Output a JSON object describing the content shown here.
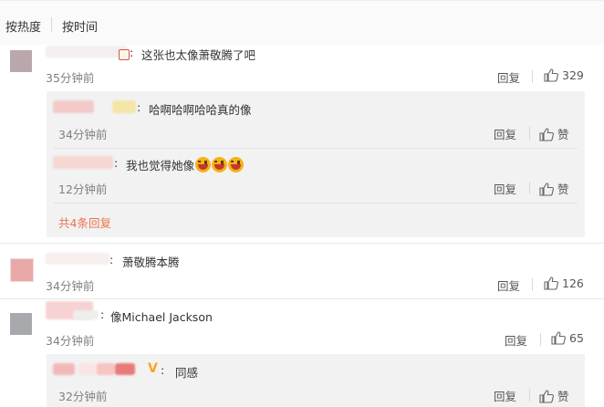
{
  "sort": {
    "hot": "按热度",
    "time": "按时间"
  },
  "comments": [
    {
      "text": "这张也太像萧敬腾了吧",
      "time": "35分钟前",
      "reply": "回复",
      "likes": "329",
      "replies": [
        {
          "text": "哈啊哈啊哈哈真的像",
          "time": "34分钟前",
          "reply": "回复",
          "like": "赞"
        },
        {
          "text": "我也觉得她像",
          "time": "12分钟前",
          "reply": "回复",
          "like": "赞",
          "emoji_count": 3
        }
      ],
      "more": "共4条回复"
    },
    {
      "text": "萧敬腾本腾",
      "time": "34分钟前",
      "reply": "回复",
      "likes": "126"
    },
    {
      "text": "像Michael Jackson",
      "time": "34分钟前",
      "reply": "回复",
      "likes": "65",
      "replies": [
        {
          "text": "同感",
          "time": "32分钟前",
          "reply": "回复",
          "like": "赞"
        }
      ]
    }
  ],
  "colors": {
    "accent": "#eb7350",
    "verified": "#f5a623"
  }
}
